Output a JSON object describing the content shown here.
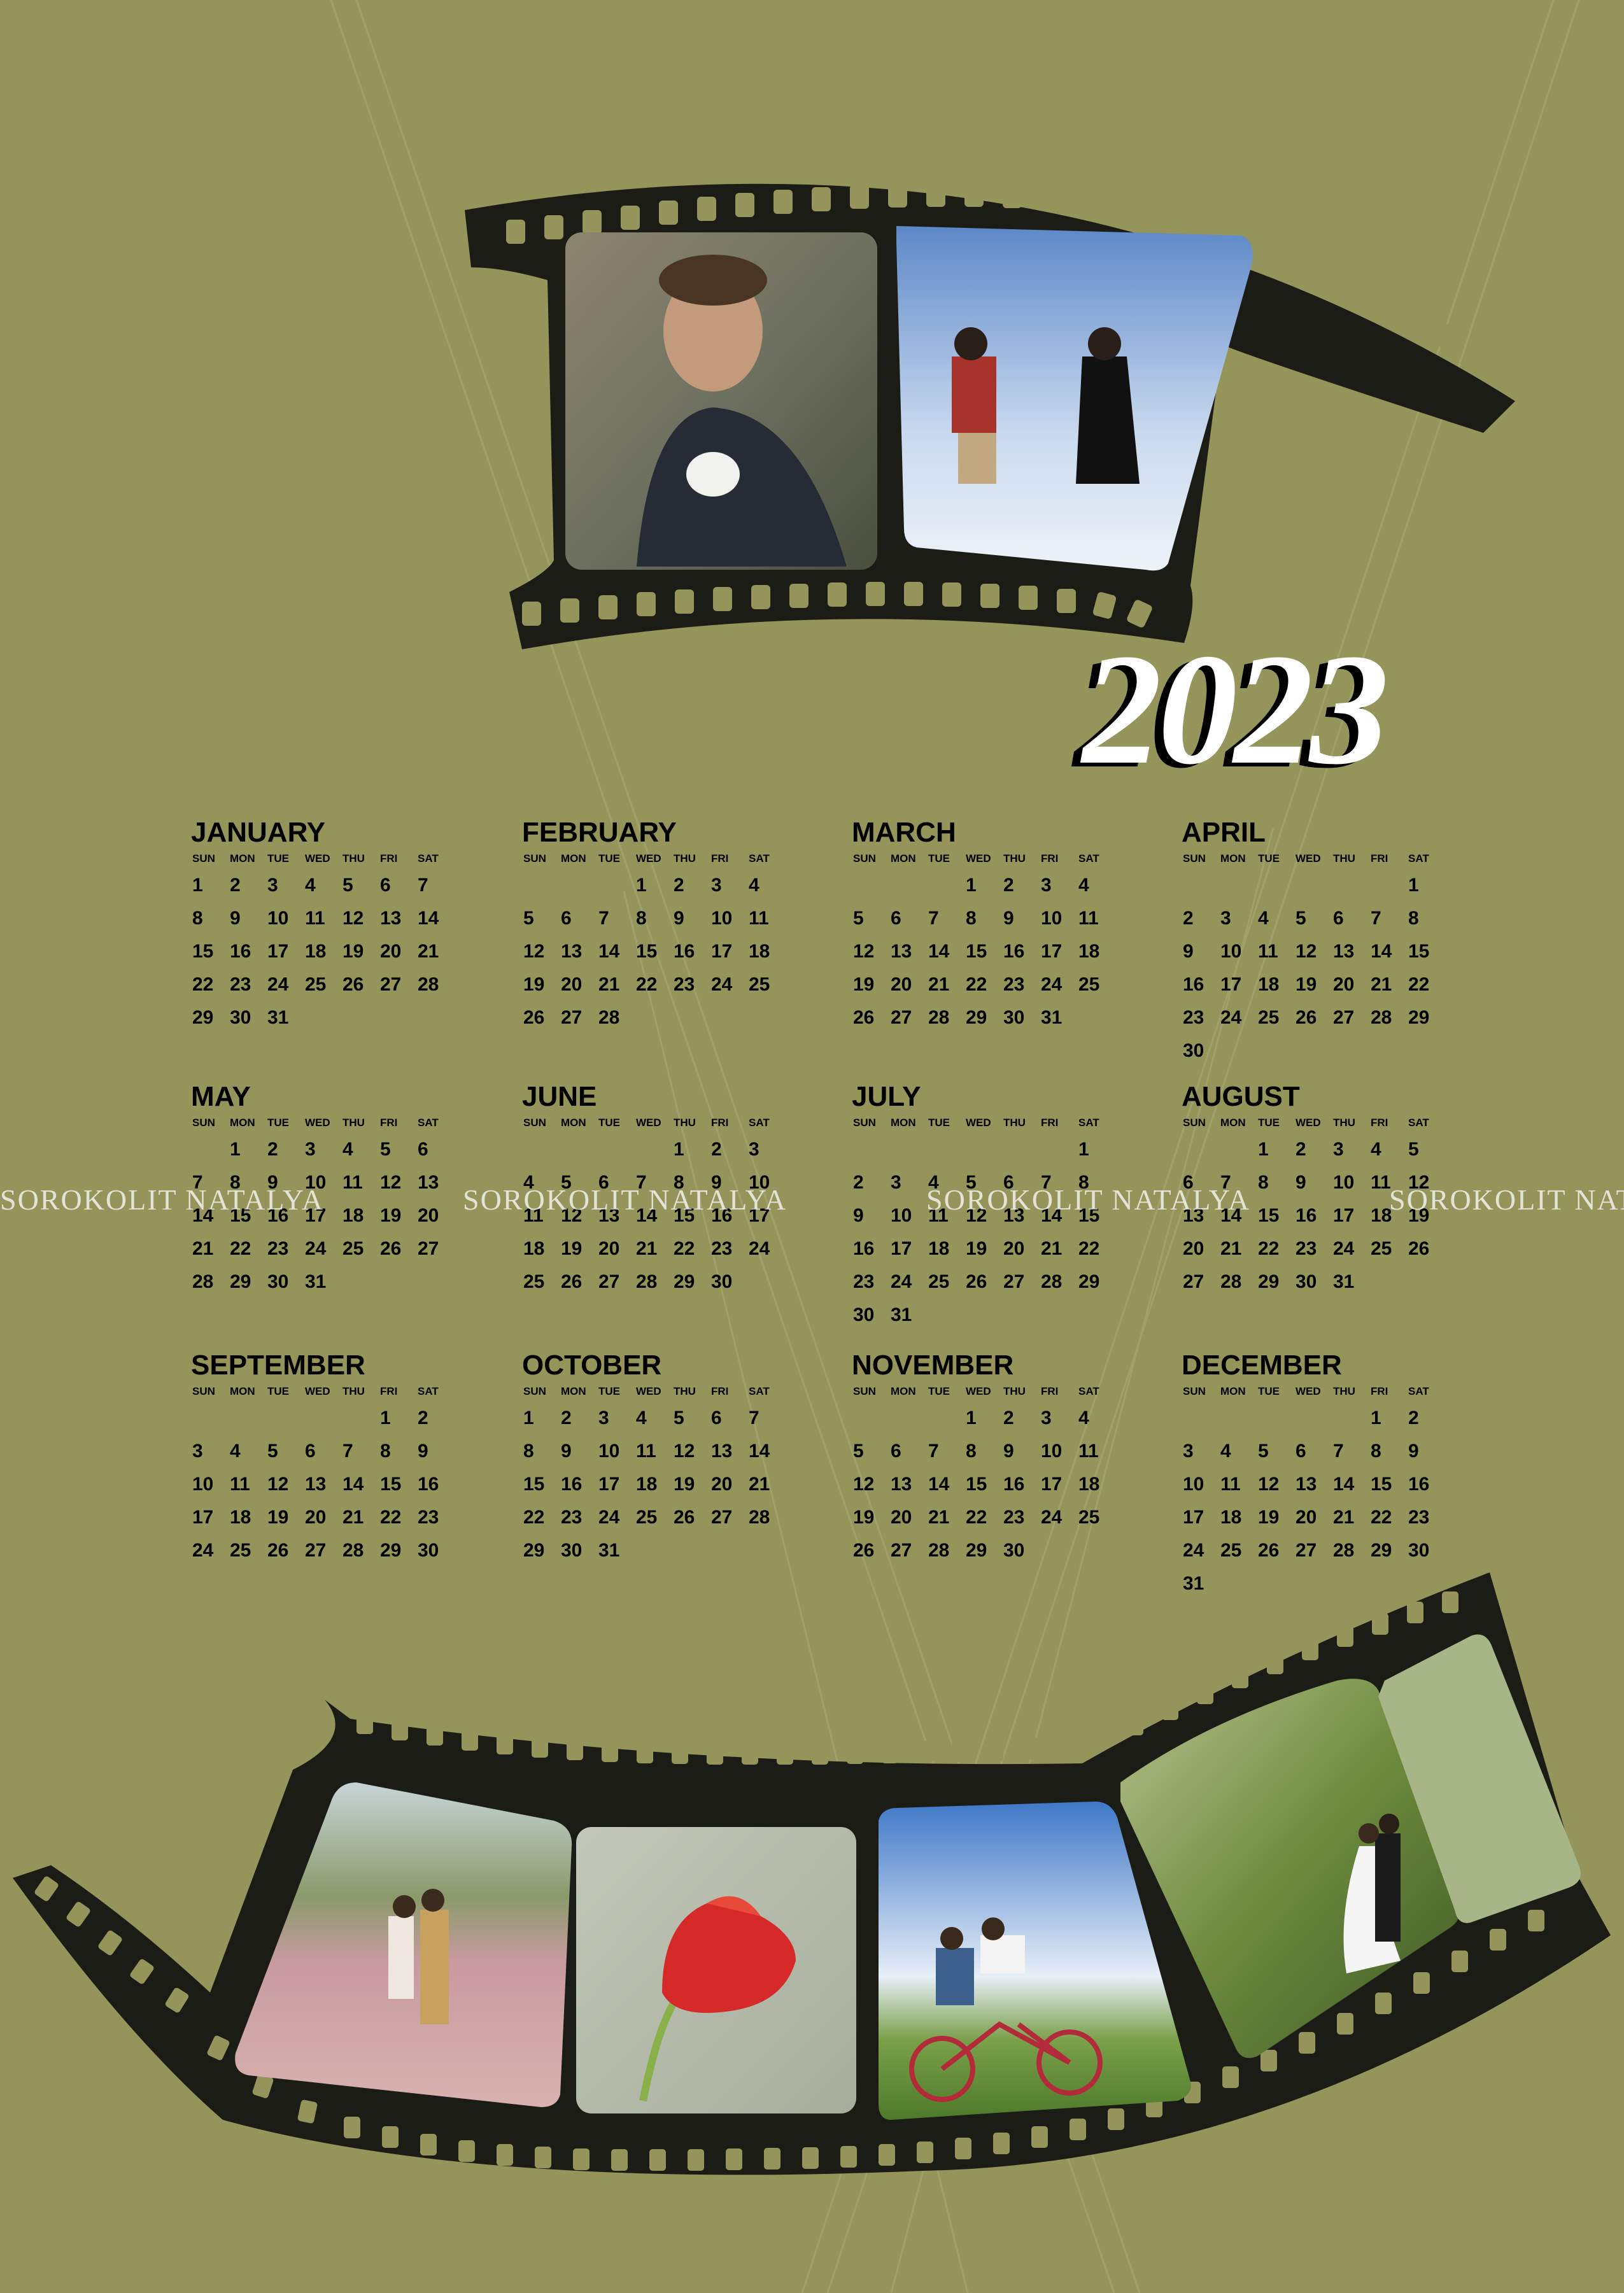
{
  "year": "2023",
  "weekdays": [
    "SUN",
    "MON",
    "TUE",
    "WED",
    "THU",
    "FRI",
    "SAT"
  ],
  "watermark": "SOROKOLIT NATALYA",
  "months": [
    {
      "name": "JANUARY",
      "start": 0,
      "days": 31
    },
    {
      "name": "FEBRUARY",
      "start": 3,
      "days": 28
    },
    {
      "name": "MARCH",
      "start": 3,
      "days": 31
    },
    {
      "name": "APRIL",
      "start": 6,
      "days": 30
    },
    {
      "name": "MAY",
      "start": 1,
      "days": 31
    },
    {
      "name": "JUNE",
      "start": 4,
      "days": 30
    },
    {
      "name": "JULY",
      "start": 6,
      "days": 31
    },
    {
      "name": "AUGUST",
      "start": 2,
      "days": 31
    },
    {
      "name": "SEPTEMBER",
      "start": 5,
      "days": 30
    },
    {
      "name": "OCTOBER",
      "start": 0,
      "days": 31
    },
    {
      "name": "NOVEMBER",
      "start": 3,
      "days": 30
    },
    {
      "name": "DECEMBER",
      "start": 5,
      "days": 31
    }
  ],
  "photos": {
    "top": [
      "smiling-man-with-cup-photo",
      "couple-jumping-sky-photo"
    ],
    "bottom": [
      "couple-kissing-field-photo",
      "red-tulip-photo",
      "couple-on-bicycle-photo",
      "wedding-couple-forest-photo"
    ]
  },
  "colors": {
    "background": "#95955b",
    "film": "#1c1c17",
    "year_text": "#ffffff"
  }
}
